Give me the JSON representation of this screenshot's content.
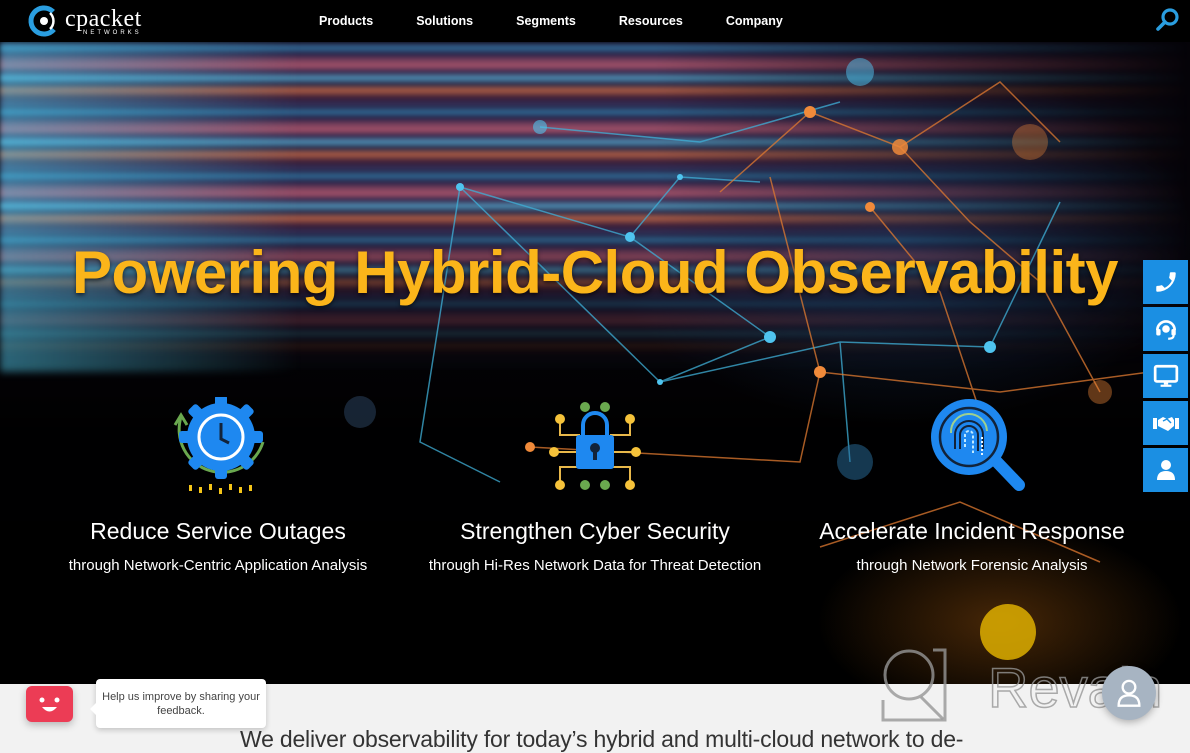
{
  "header": {
    "logo": {
      "name": "cpacket",
      "sub": "NETWORKS"
    },
    "nav": [
      {
        "label": "Products"
      },
      {
        "label": "Solutions"
      },
      {
        "label": "Segments"
      },
      {
        "label": "Resources"
      },
      {
        "label": "Company"
      }
    ],
    "search_icon": "search-icon"
  },
  "hero": {
    "title": "Powering Hybrid-Cloud Observability",
    "features": [
      {
        "icon": "gear-clock-icon",
        "title": "Reduce Service Outages",
        "subtitle": "through Network-Centric Application Analysis"
      },
      {
        "icon": "circuit-lock-icon",
        "title": "Strengthen Cyber Security",
        "subtitle": "through Hi-Res Network Data for Threat Detection"
      },
      {
        "icon": "fingerprint-magnifier-icon",
        "title": "Accelerate Incident Response",
        "subtitle": "through Network Forensic Analysis"
      }
    ]
  },
  "contact_rail": [
    {
      "icon": "phone-icon"
    },
    {
      "icon": "headset-icon"
    },
    {
      "icon": "monitor-icon"
    },
    {
      "icon": "handshake-icon"
    },
    {
      "icon": "user-icon"
    }
  ],
  "bottom": {
    "text": "We deliver observability for today’s hybrid and multi-cloud network to de-"
  },
  "feedback": {
    "message": "Help us improve by sharing your feedback."
  },
  "watermark": {
    "text": "Revain"
  },
  "colors": {
    "accent_blue": "#1b8fe3",
    "title_yellow": "#fbb51a",
    "feedback_red": "#ec3c55",
    "header_bg": "#000000",
    "bottom_bg": "#f2f2f2"
  }
}
